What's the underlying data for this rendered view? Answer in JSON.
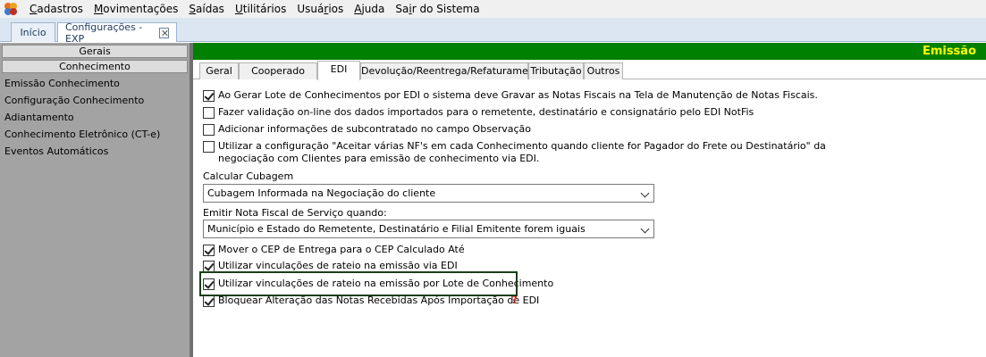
{
  "menu": {
    "items": [
      {
        "ul": "C",
        "rest": "adastros"
      },
      {
        "ul": "M",
        "rest": "ovimentações"
      },
      {
        "ul": "S",
        "rest": "aídas"
      },
      {
        "ul": "U",
        "rest": "tilitários"
      },
      {
        "ul": "",
        "rest": "Usuários"
      },
      {
        "ul": "A",
        "rest": "juda"
      },
      {
        "ul": "",
        "rest": "Sair do Sistema"
      }
    ],
    "usuarios_pre": "Usuá",
    "usuarios_ul": "r",
    "usuarios_post": "ios",
    "sair_pre": "Sa",
    "sair_ul": "i",
    "sair_post": "r do Sistema"
  },
  "doc_tabs": {
    "inicio": "Início",
    "config": "Configurações - EXP"
  },
  "left": {
    "header_gerais": "Gerais",
    "header_conhecimento": "Conhecimento",
    "items": [
      "Emissão Conhecimento",
      "Configuração Conhecimento",
      "Adiantamento",
      "Conhecimento Eletrônico (CT-e)",
      "Eventos Automáticos"
    ]
  },
  "section_title": "Emissão",
  "tabs": [
    "Geral",
    "Cooperado",
    "EDI",
    "Devolução/Reentrega/Refaturamento",
    "Tributação",
    "Outros"
  ],
  "form": {
    "cb1": "Ao Gerar Lote de Conhecimentos por EDI o sistema deve Gravar as Notas Fiscais na Tela de Manutenção de Notas Fiscais.",
    "cb2": "Fazer validação on-line dos dados importados para o remetente, destinatário e consignatário pelo EDI NotFis",
    "cb3": "Adicionar informações de subcontratado no campo Observação",
    "cb4_line1": "Utilizar a configuração \"Aceitar várias NF's em cada Conhecimento quando cliente for Pagador do Frete ou Destinatário\" da",
    "cb4_line2": "negociação com Clientes para emissão  de conhecimento via EDI.",
    "cubagem_label": "Calcular Cubagem",
    "cubagem_value": "Cubagem Informada na Negociação do cliente",
    "nfs_label": "Emitir Nota Fiscal de Serviço quando:",
    "nfs_value": "Município e Estado do Remetente, Destinatário e Filial Emitente forem iguais",
    "cb5": "Mover o CEP de Entrega para o CEP Calculado Até",
    "cb6": "Utilizar vinculações de rateio na emissão via EDI",
    "cb7": "Utilizar vinculações de rateio na emissão por Lote de Conhecimento",
    "cb8": "Bloquear Alteração das Notas Recebidas Após Importação de EDI",
    "help": "?"
  },
  "colors": {
    "section_header_bg": "#008000",
    "section_header_text": "#ffff00",
    "left_panel_bg": "#a3a3a3",
    "highlight_border": "#1c3d1c",
    "help_mark": "#e02020"
  }
}
